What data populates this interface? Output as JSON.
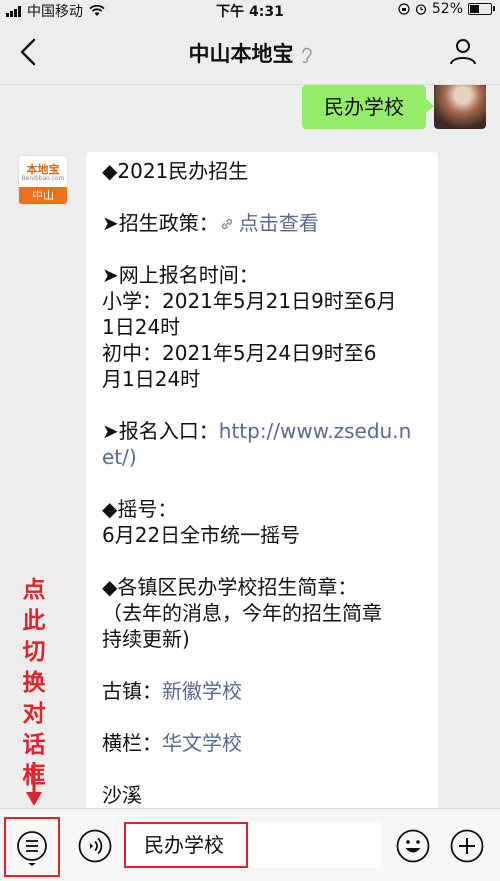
{
  "status_bar": {
    "carrier": "中国移动",
    "time": "下午 4:31",
    "battery": "52%",
    "battery_level": 0.52
  },
  "nav": {
    "title": "中山本地宝",
    "icons": [
      "back-arrow-icon",
      "ear-icon",
      "profile-icon"
    ]
  },
  "chat": {
    "outgoing": {
      "text": "民办学校"
    },
    "official_avatar": {
      "brand": "本地宝",
      "sub": "Bendibao.com",
      "city": "中山"
    },
    "incoming": {
      "heading": "◆2021民办招生",
      "policy_label": "➤招生政策：",
      "policy_link": "点击查看",
      "signup_time_label": "➤网上报名时间：",
      "primary_line1": "小学：2021年5月21日9时至6月",
      "primary_line2": "1日24时",
      "middle_line1": "初中：2021年5月24日9时至6",
      "middle_line2": "月1日24时",
      "entry_label": "➤报名入口：",
      "entry_link1": "http://www.zsedu.n",
      "entry_link2": "et/)",
      "entry_tail": ")",
      "lottery_label": "◆摇号：",
      "lottery_text": "6月22日全市统一摇号",
      "brochure_label": "◆各镇区民办学校招生简章：",
      "brochure_note1": "（去年的消息，今年的招生简章",
      "brochure_note2": "持续更新)",
      "guzhen_label": "古镇：",
      "guzhen_link": "新徽学校",
      "henglan_label": "横栏：",
      "henglan_link": "华文学校",
      "partial_next": "沙溪"
    }
  },
  "annotation": {
    "chars": [
      "点",
      "此",
      "切",
      "换",
      "对",
      "话",
      "框"
    ],
    "color": "#e0242b"
  },
  "input_bar": {
    "text": "民办学校",
    "icons": [
      "menu-list-icon",
      "voice-icon",
      "emoji-icon",
      "plus-icon"
    ]
  },
  "colors": {
    "outgoing_bubble": "#95ec69",
    "link": "#576b95",
    "highlight": "#e0242b",
    "background": "#ededed"
  }
}
